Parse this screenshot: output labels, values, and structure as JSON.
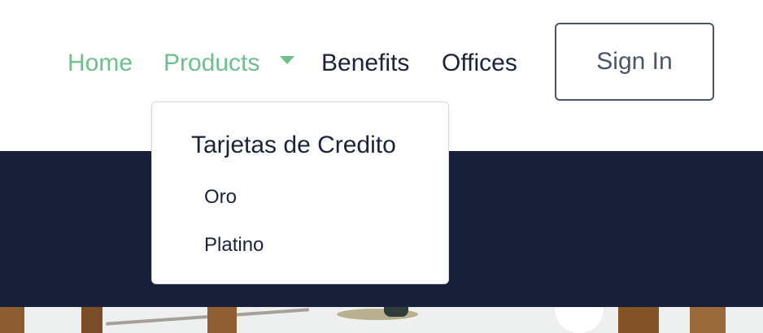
{
  "nav": {
    "home": "Home",
    "products": "Products",
    "benefits": "Benefits",
    "offices": "Offices",
    "sign_in": "Sign In"
  },
  "dropdown": {
    "heading": "Tarjetas de Credito",
    "items": [
      "Oro",
      "Platino"
    ]
  },
  "icons": {
    "products_caret": "caret-down-icon"
  },
  "colors": {
    "accent": "#6cc08b",
    "text_dark": "#1c2238",
    "band": "#19213a",
    "signin_border": "#4a5568"
  }
}
